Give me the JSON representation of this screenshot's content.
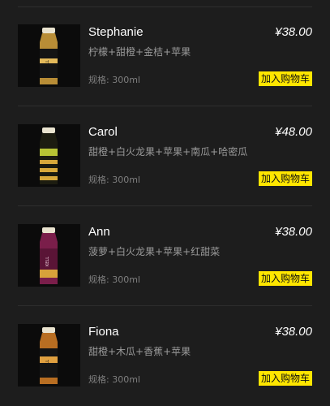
{
  "products": [
    {
      "name": "Stephanie",
      "price": "¥38.00",
      "ingredients": "柠檬+甜橙+金桔+苹果",
      "spec": "规格: 300ml",
      "button": "加入购物车",
      "bottle_color": "#c9a24a",
      "label_color": "#e3b95a"
    },
    {
      "name": "Carol",
      "price": "¥48.00",
      "ingredients": "甜橙+白火龙果+苹果+南瓜+哈密瓜",
      "spec": "规格: 300ml",
      "button": "加入购物车",
      "bottle_color": "#1f2a10",
      "label_color": "#c6d23a"
    },
    {
      "name": "Ann",
      "price": "¥38.00",
      "ingredients": "菠萝+白火龙果+苹果+红甜菜",
      "spec": "规格: 300ml",
      "button": "加入购物车",
      "bottle_color": "#7a1e4a",
      "label_color": "#a23a6e"
    },
    {
      "name": "Fiona",
      "price": "¥38.00",
      "ingredients": "甜橙+木瓜+香蕉+苹果",
      "spec": "规格: 300ml",
      "button": "加入购物车",
      "bottle_color": "#c07a2a",
      "label_color": "#e0a040"
    }
  ],
  "colors": {
    "background": "#1d1d1d",
    "accent": "#ffe600",
    "text_primary": "#ffffff",
    "text_secondary": "#9a9a9a"
  }
}
